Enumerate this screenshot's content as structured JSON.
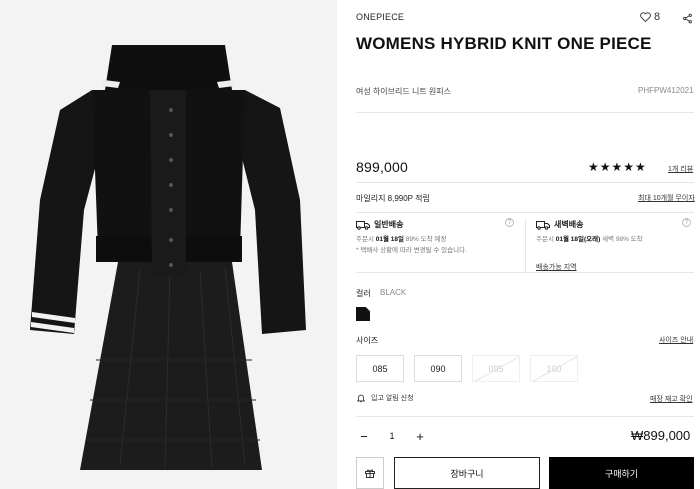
{
  "product": {
    "brand": "ONEPIECE",
    "title": "WOMENS HYBRID KNIT ONE PIECE",
    "subtitle": "여성 하이브리드 니트 원피스",
    "code": "PHFPW412021",
    "likes": "8",
    "price": "899,000",
    "stars": "★★★★★",
    "rating": 5,
    "reviews": "1개 리뷰"
  },
  "benefits": {
    "mileage": "마일리지 8,990P 적립",
    "coupon": "최대 10개월 무이자"
  },
  "shipping": {
    "standard": {
      "title": "일반배송",
      "line1_prefix": "주문시 ",
      "line1_bold": "01월 18일",
      "line1_suffix": " 89% 도착 예정",
      "line2": "* 택배사 상황에 따라 변경될 수 있습니다."
    },
    "dawn": {
      "title": "새벽배송",
      "line1_prefix": "주문시 ",
      "line1_bold": "01월 18일(오래)",
      "line1_suffix": " 새벽 98% 도착",
      "link": "배송가능 지역"
    },
    "help": "?"
  },
  "color": {
    "label": "컬러",
    "value": "BLACK",
    "swatch_hex": "#111111"
  },
  "size": {
    "label": "사이즈",
    "guide": "사이즈 안내",
    "options": [
      {
        "label": "085",
        "available": true
      },
      {
        "label": "090",
        "available": true
      },
      {
        "label": "095",
        "available": false
      },
      {
        "label": "100",
        "available": false
      }
    ]
  },
  "restock": {
    "notify": "입고 알림 신청",
    "request": "매장 재고 확인"
  },
  "quantity": {
    "minus": "−",
    "value": "1",
    "plus": "+"
  },
  "total": "₩899,000",
  "actions": {
    "cart": "장바구니",
    "buy": "구매하기"
  },
  "colors": {
    "accent": "#000000",
    "image_bg": "#f3f3f3"
  }
}
